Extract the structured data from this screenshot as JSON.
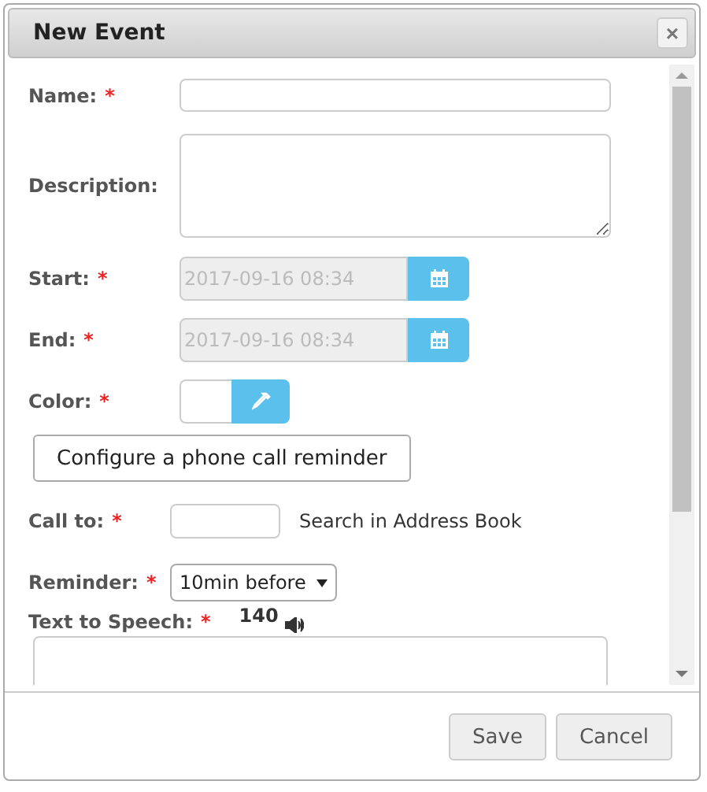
{
  "window": {
    "title": "New Event",
    "close": "×"
  },
  "fields": [
    {
      "kind": "text",
      "label": "Name:",
      "required_mark": "*"
    },
    {
      "kind": "textarea",
      "label": "Description:"
    },
    {
      "kind": "date",
      "label": "Start:",
      "required_mark": "*",
      "value": "2017-09-16 08:34",
      "disabled": true
    },
    {
      "kind": "date",
      "label": "End:",
      "required_mark": "*",
      "value": "2017-09-16 08:34",
      "disabled": true
    },
    {
      "kind": "color",
      "label": "Color:",
      "required_mark": "*"
    },
    {
      "kind": "button",
      "label": "Configure a phone call reminder"
    },
    {
      "kind": "callto",
      "label": "Call to:",
      "required_mark": "*",
      "link": "Search in Address Book"
    },
    {
      "kind": "select",
      "label": "Reminder:",
      "required_mark": "*",
      "value": "10min before"
    },
    {
      "kind": "tts",
      "label": "Text to Speech:",
      "required_mark": "*",
      "count": "140"
    }
  ],
  "buttons": [
    "Save",
    "Cancel"
  ]
}
